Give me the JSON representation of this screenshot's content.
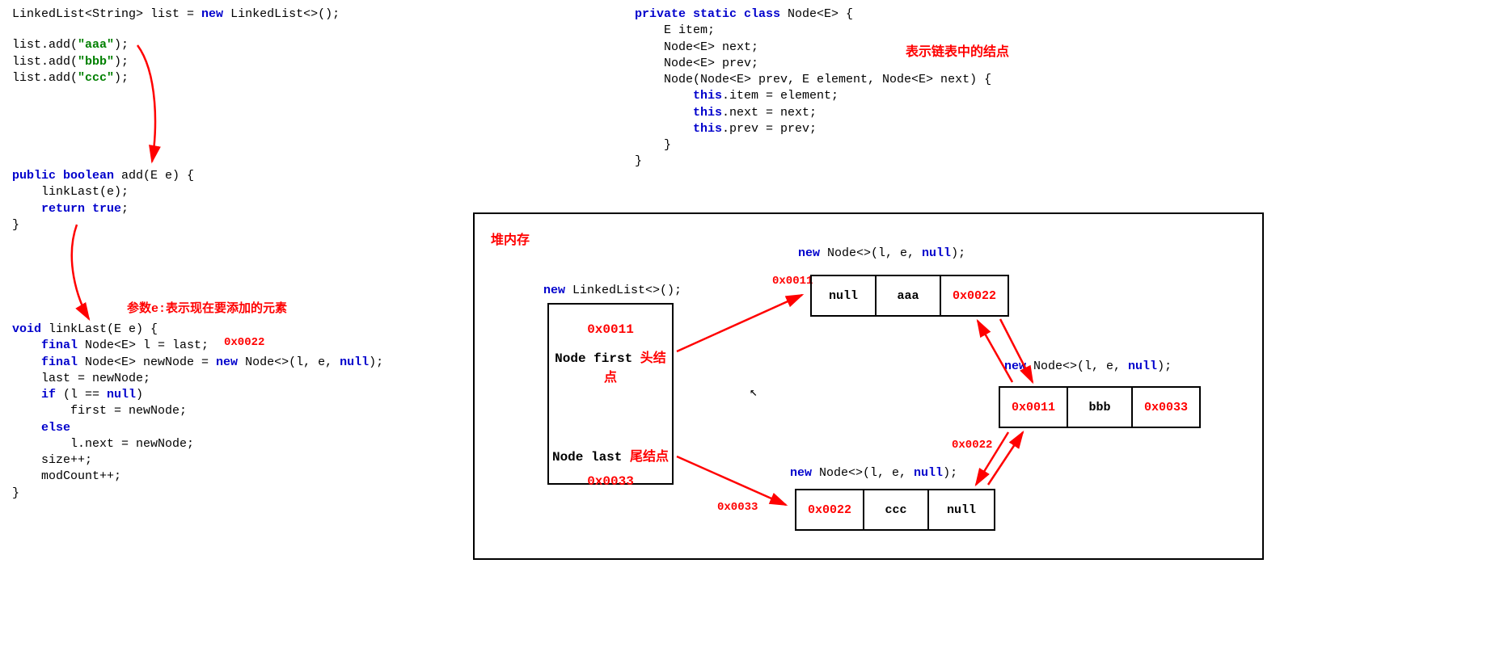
{
  "code_left_1": {
    "l1_pre": "LinkedList<String> list = ",
    "l1_kw": "new",
    "l1_post": " LinkedList<>();",
    "l2a": "list.add(",
    "l2s": "\"aaa\"",
    "l2e": ");",
    "l3a": "list.add(",
    "l3s": "\"bbb\"",
    "l3e": ");",
    "l4a": "list.add(",
    "l4s": "\"ccc\"",
    "l4e": ");"
  },
  "code_add": {
    "l1": "public boolean",
    "l1b": " add(E e) {",
    "l2": "    linkLast(e);",
    "l3a": "    ",
    "l3kw": "return true",
    "l3b": ";",
    "l4": "}"
  },
  "annot1": "参数e:表示现在要添加的元素",
  "addr_annot": "0x0022",
  "code_linklast": {
    "l1a": "void",
    "l1b": " linkLast(E e) {",
    "l2a": "    final",
    "l2b": " Node<E> l = last;",
    "l3a": "    final",
    "l3b": " Node<E> newNode = ",
    "l3kw": "new",
    "l3c": " Node<>(l, e, ",
    "l3kw2": "null",
    "l3d": ");",
    "l4": "    last = newNode;",
    "l5a": "    if",
    "l5b": " (l == ",
    "l5kw": "null",
    "l5c": ")",
    "l6": "        first = newNode;",
    "l7": "    else",
    "l8": "        l.next = newNode;",
    "l9": "    size++;",
    "l10": "    modCount++;",
    "l11": "}"
  },
  "code_node": {
    "l1a": "private static class",
    "l1b": " Node<E> {",
    "l2": "    E item;",
    "l3": "    Node<E> next;",
    "l4": "    Node<E> prev;",
    "blank": "",
    "l5": "    Node(Node<E> prev, E element, Node<E> next) {",
    "l6a": "        this",
    "l6b": ".item = element;",
    "l7a": "        this",
    "l7b": ".next = next;",
    "l8a": "        this",
    "l8b": ".prev = prev;",
    "l9": "    }",
    "l10": "}"
  },
  "annot_node": "表示链表中的结点",
  "heap_title": "堆内存",
  "ll_header": "new",
  "ll_header2": " LinkedList<>();",
  "ll_addr_first": "0x0011",
  "ll_first": "Node first",
  "ll_first_cn": "头结点",
  "ll_last": "Node last",
  "ll_last_cn": "尾结点",
  "ll_addr_last": "0x0033",
  "new_node_label_kw": "new",
  "new_node_label1": " Node<>(l, e, ",
  "new_node_label_null": "null",
  "new_node_label_end": ");",
  "nodeA": {
    "prev": "null",
    "item": "aaa",
    "next": "0x0022",
    "addr": "0x0011"
  },
  "nodeB": {
    "prev": "0x0011",
    "item": "bbb",
    "next": "0x0033",
    "addr": "0x0022"
  },
  "nodeC": {
    "prev": "0x0022",
    "item": "ccc",
    "next": "null",
    "addr": "0x0033"
  }
}
